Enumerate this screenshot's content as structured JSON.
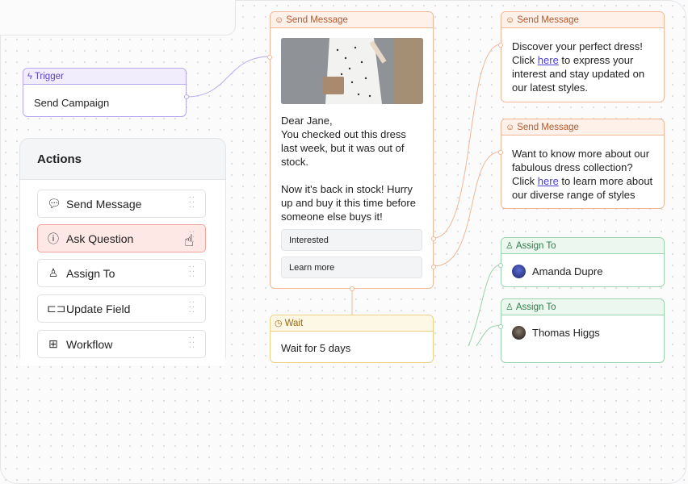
{
  "trigger": {
    "header": "Trigger",
    "label": "Send Campaign"
  },
  "send_message_main": {
    "header": "Send Message",
    "body_lines": [
      "Dear Jane,",
      "You checked out this dress",
      "last week, but it was out of",
      "stock.",
      "",
      "Now it's back in stock! Hurry",
      "up and buy it this time before",
      "someone else buys it!"
    ],
    "buttons": [
      "Interested",
      "Learn more"
    ]
  },
  "send_message_1": {
    "header": "Send Message",
    "line1": "Discover your perfect dress!",
    "click_pre": "Click ",
    "link": "here",
    "click_post": " to express your",
    "line3": "interest and stay updated on",
    "line4": "our latest styles."
  },
  "send_message_2": {
    "header": "Send Message",
    "line1": "Want to know more about our",
    "line2": "fabulous dress collection?",
    "click_pre": "Click ",
    "link": "here",
    "click_post": " to learn more about",
    "line4": "our diverse range of styles"
  },
  "assign_1": {
    "header": "Assign To",
    "name": "Amanda Dupre"
  },
  "assign_2": {
    "header": "Assign To",
    "name": "Thomas Higgs"
  },
  "wait": {
    "header": "Wait",
    "body": "Wait for 5 days"
  },
  "actions": {
    "title": "Actions",
    "items": [
      {
        "label": "Send Message",
        "icon": "message-icon"
      },
      {
        "label": "Ask Question",
        "icon": "question-icon"
      },
      {
        "label": "Assign To",
        "icon": "user-plus-icon"
      },
      {
        "label": "Update Field",
        "icon": "field-icon"
      },
      {
        "label": "Workflow",
        "icon": "workflow-icon"
      }
    ]
  },
  "colors": {
    "orange": "#f2b796",
    "purple": "#b9a8ef",
    "green": "#9bd3ac",
    "yellow": "#efcf82",
    "selected": "#fde8e6"
  }
}
